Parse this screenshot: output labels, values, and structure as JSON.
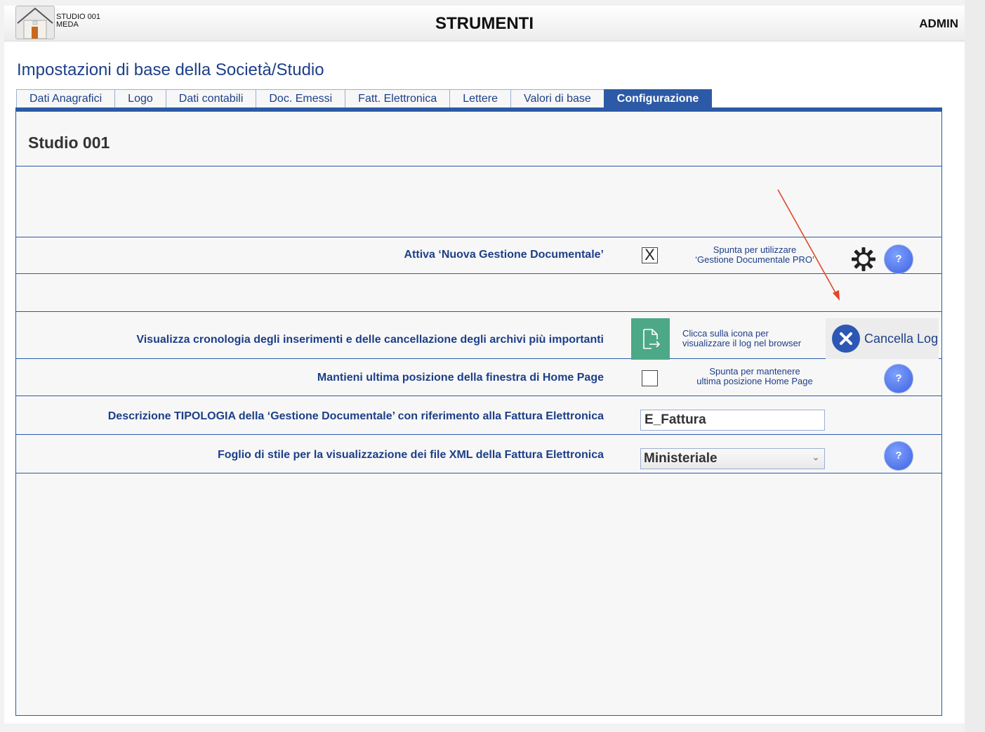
{
  "header": {
    "studio_line1": "STUDIO 001",
    "studio_line2": "MEDA",
    "title": "STRUMENTI",
    "user": "ADMIN"
  },
  "page_title": "Impostazioni  di base della Società/Studio",
  "tabs": [
    {
      "label": "Dati Anagrafici",
      "active": false
    },
    {
      "label": "Logo",
      "active": false
    },
    {
      "label": "Dati contabili",
      "active": false
    },
    {
      "label": "Doc. Emessi",
      "active": false
    },
    {
      "label": "Fatt. Elettronica",
      "active": false
    },
    {
      "label": "Lettere",
      "active": false
    },
    {
      "label": "Valori di base",
      "active": false
    },
    {
      "label": "Configurazione",
      "active": true
    }
  ],
  "panel": {
    "studio_name": "Studio 001",
    "rows": {
      "nuova_gestione": {
        "label": "Attiva ‘Nuova Gestione Documentale’",
        "checked": true,
        "check_mark": "X",
        "hint_line1": "Spunta per utilizzare",
        "hint_line2": "‘Gestione Documentale PRO’",
        "gear_icon": "gear-icon",
        "help_label": "?"
      },
      "cronologia": {
        "label": "Visualizza cronologia degli inserimenti e delle cancellazione degli archivi più importanti",
        "hint_line1": "Clicca sulla icona per",
        "hint_line2": "visualizzare il log nel browser",
        "open_icon": "document-open-icon",
        "cancel_label": "Cancella Log"
      },
      "posizione": {
        "label": "Mantieni ultima posizione della finestra di Home Page",
        "checked": false,
        "hint_line1": "Spunta per mantenere",
        "hint_line2": "ultima posizione Home Page",
        "help_label": "?"
      },
      "tipologia": {
        "label": "Descrizione TIPOLOGIA della ‘Gestione Documentale’ con riferimento alla Fattura Elettronica",
        "value": "E_Fattura"
      },
      "foglio_stile": {
        "label": "Foglio di stile per la visualizzazione dei file XML della Fattura Elettronica",
        "selected": "Ministeriale",
        "help_label": "?"
      }
    }
  },
  "colors": {
    "accent": "#2c5aa6",
    "text_blue": "#1d3f88",
    "open_log_green": "#4da887",
    "help_blue": "#4a6ff0",
    "annotation_red": "#e0462a"
  }
}
